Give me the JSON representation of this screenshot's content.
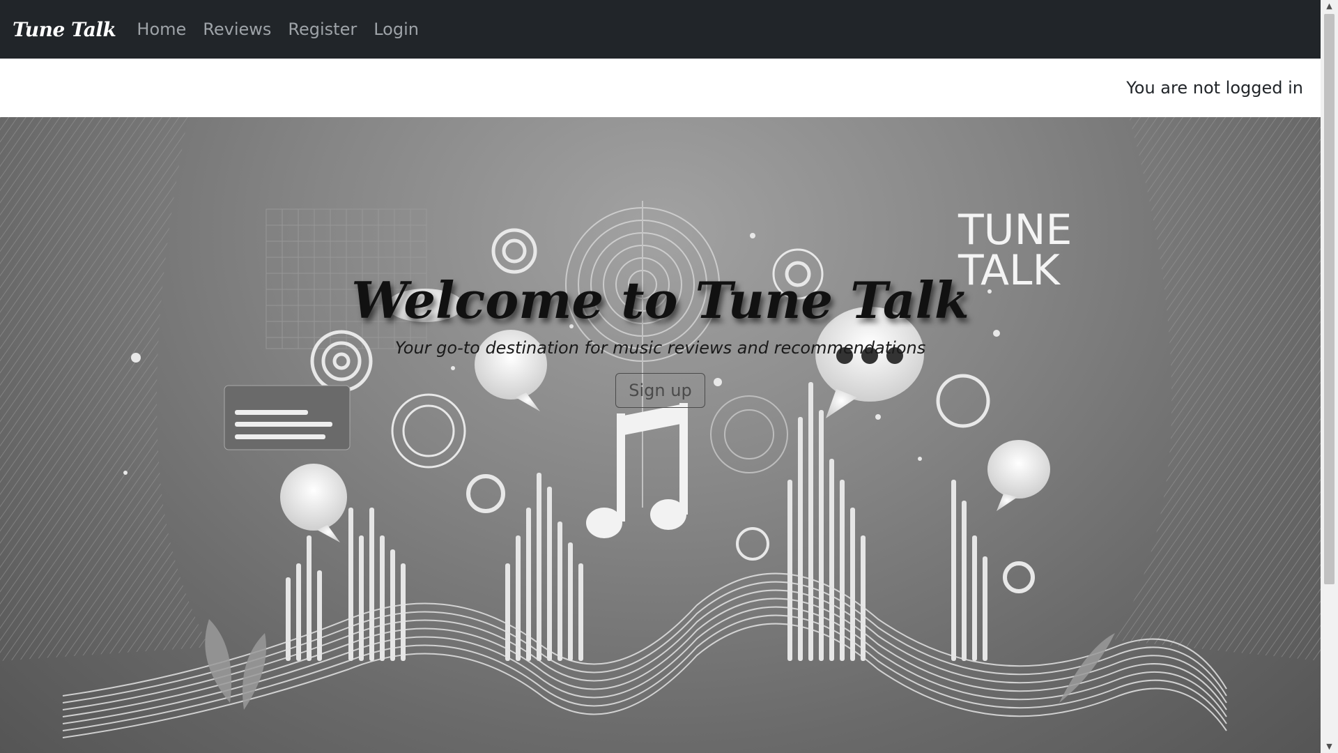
{
  "navbar": {
    "brand": "Tune Talk",
    "links": [
      "Home",
      "Reviews",
      "Register",
      "Login"
    ]
  },
  "status": {
    "text": "You are not logged in"
  },
  "hero": {
    "title": "Welcome to Tune Talk",
    "subtitle": "Your go-to destination for music reviews and recommendations",
    "button_label": "Sign up",
    "image_logo_text": [
      "TUNE",
      "TALK"
    ]
  },
  "scrollbar": {
    "up_icon": "▲",
    "down_icon": "▼"
  },
  "colors": {
    "navbar_bg": "#212529",
    "nav_link": "#9ea3a8",
    "brand": "#ffffff",
    "hero_gray": "#858585"
  }
}
